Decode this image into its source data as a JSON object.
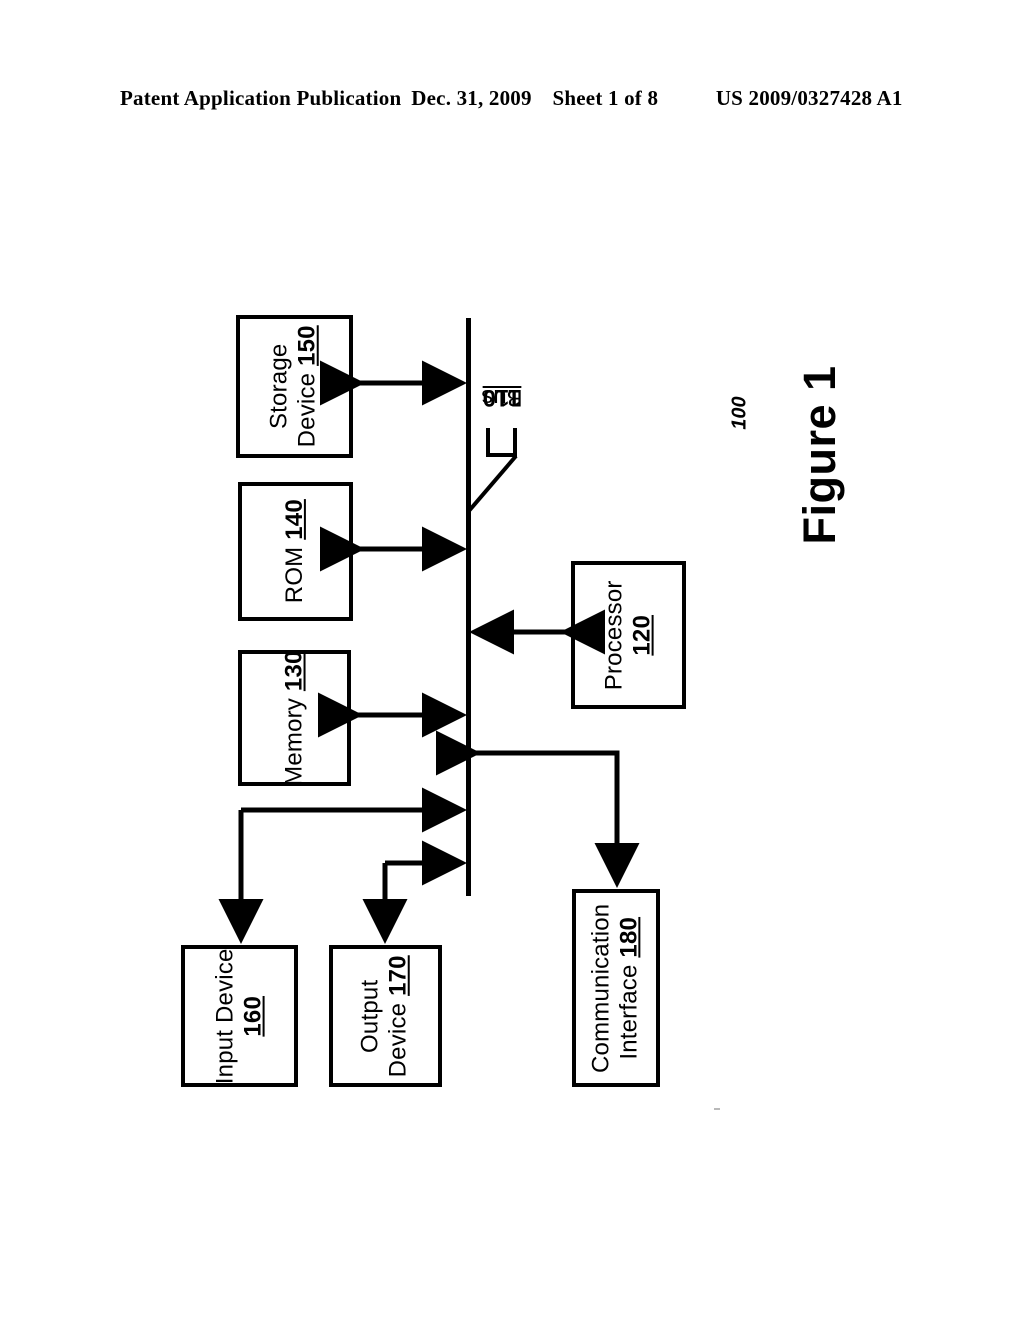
{
  "header": {
    "publication": "Patent Application Publication",
    "date": "Dec. 31, 2009",
    "sheet": "Sheet 1 of 8",
    "publication_number": "US 2009/0327428 A1"
  },
  "figure": {
    "caption": "Figure 1",
    "system_reference": "100"
  },
  "diagram": {
    "bus": {
      "label": "Bus",
      "ref": "110"
    },
    "blocks": [
      {
        "id": "storage",
        "line1": "Storage",
        "line2": "Device",
        "ref": "150",
        "ref_on_line": 2
      },
      {
        "id": "rom",
        "line1": "ROM",
        "line2": "",
        "ref": "140",
        "ref_on_line": 1
      },
      {
        "id": "memory",
        "line1": "Memory",
        "line2": "",
        "ref": "130",
        "ref_on_line": 1
      },
      {
        "id": "processor",
        "line1": "Processor",
        "line2": "",
        "ref": "120",
        "ref_on_line": 2
      },
      {
        "id": "input",
        "line1": "Input Device",
        "line2": "",
        "ref": "160",
        "ref_on_line": 2
      },
      {
        "id": "output",
        "line1": "Output",
        "line2": "Device",
        "ref": "170",
        "ref_on_line": 2
      },
      {
        "id": "comm",
        "line1": "Communication",
        "line2": "Interface",
        "ref": "180",
        "ref_on_line": 2
      }
    ],
    "connections": [
      {
        "from": "storage",
        "to": "bus",
        "style": "double-arrow"
      },
      {
        "from": "rom",
        "to": "bus",
        "style": "double-arrow"
      },
      {
        "from": "memory",
        "to": "bus",
        "style": "double-arrow"
      },
      {
        "from": "processor",
        "to": "bus",
        "style": "double-arrow"
      },
      {
        "from": "bus",
        "to": "input",
        "style": "elbow-double-arrow"
      },
      {
        "from": "bus",
        "to": "output",
        "style": "elbow-double-arrow"
      },
      {
        "from": "bus",
        "to": "comm",
        "style": "elbow-double-arrow"
      }
    ]
  },
  "colors": {
    "ink": "#000000",
    "paper": "#ffffff"
  }
}
